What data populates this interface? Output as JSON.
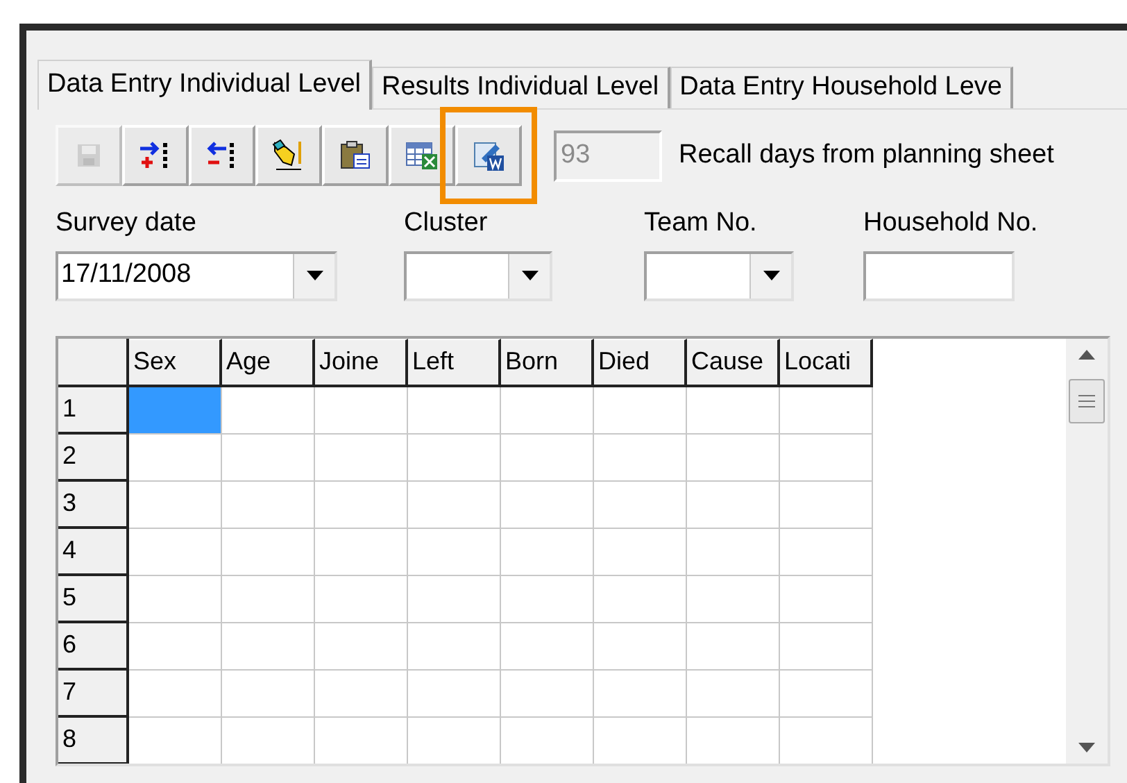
{
  "tabs": [
    {
      "label": "Data Entry Individual Level",
      "selected": true
    },
    {
      "label": "Results Individual Level",
      "selected": false
    },
    {
      "label": "Data Entry Household Leve",
      "selected": false
    }
  ],
  "toolbar": [
    {
      "kind": "save",
      "disabled": true,
      "highlighted": false
    },
    {
      "kind": "add-column",
      "disabled": false,
      "highlighted": false
    },
    {
      "kind": "remove-column",
      "disabled": false,
      "highlighted": false
    },
    {
      "kind": "edit",
      "disabled": false,
      "highlighted": false
    },
    {
      "kind": "paste",
      "disabled": false,
      "highlighted": false
    },
    {
      "kind": "excel",
      "disabled": false,
      "highlighted": false
    },
    {
      "kind": "word",
      "disabled": false,
      "highlighted": true
    }
  ],
  "recall_days": {
    "value": "93",
    "disabled": true,
    "label": "Recall days from planning sheet"
  },
  "fields": [
    {
      "kind": "combo",
      "label": "Survey date",
      "value": "17/11/2008"
    },
    {
      "kind": "combo",
      "label": "Cluster"
    },
    {
      "kind": "combo",
      "label": "Team No."
    },
    {
      "kind": "text",
      "label": "Household No."
    }
  ],
  "grid": {
    "columns": [
      "Sex",
      "Age",
      "Joine",
      "Left",
      "Born",
      "Died",
      "Cause",
      "Locati"
    ],
    "rows": [
      {
        "label": "1",
        "selected_cells": [
          true,
          false,
          false,
          false,
          false,
          false,
          false,
          false
        ]
      },
      {
        "label": "2",
        "selected_cells": [
          false,
          false,
          false,
          false,
          false,
          false,
          false,
          false
        ]
      },
      {
        "label": "3",
        "selected_cells": [
          false,
          false,
          false,
          false,
          false,
          false,
          false,
          false
        ]
      },
      {
        "label": "4",
        "selected_cells": [
          false,
          false,
          false,
          false,
          false,
          false,
          false,
          false
        ]
      },
      {
        "label": "5",
        "selected_cells": [
          false,
          false,
          false,
          false,
          false,
          false,
          false,
          false
        ]
      },
      {
        "label": "6",
        "selected_cells": [
          false,
          false,
          false,
          false,
          false,
          false,
          false,
          false
        ]
      },
      {
        "label": "7",
        "selected_cells": [
          false,
          false,
          false,
          false,
          false,
          false,
          false,
          false
        ]
      },
      {
        "label": "8",
        "selected_cells": [
          false,
          false,
          false,
          false,
          false,
          false,
          false,
          false
        ]
      }
    ]
  }
}
